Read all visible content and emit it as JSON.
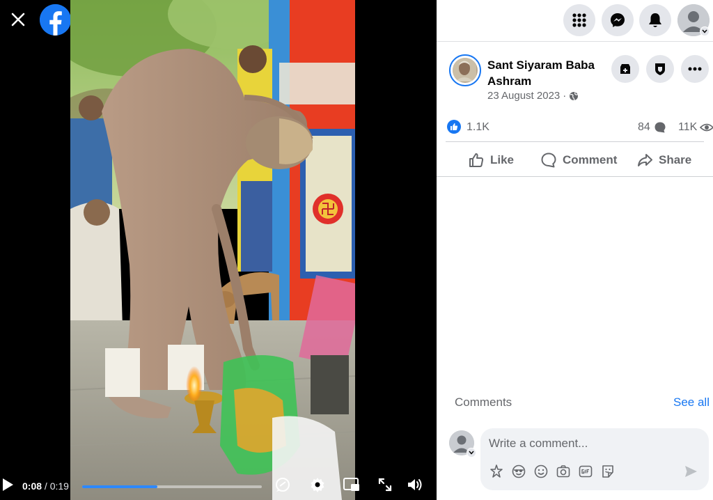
{
  "colors": {
    "brand": "#1877f2",
    "progress": "#2d88ff",
    "muted_text": "#65676b",
    "button_bg": "#e4e6eb"
  },
  "video": {
    "current_time": "0:08",
    "time_separator": "/",
    "duration": "0:19",
    "progress_fraction": 0.42
  },
  "post": {
    "page_name": "Sant Siyaram Baba Ashram",
    "date": "23 August 2023",
    "date_separator": "·",
    "audience_icon": "globe-icon"
  },
  "stats": {
    "reactions": "1.1K",
    "comments": "84",
    "views": "11K"
  },
  "actions": {
    "like": "Like",
    "comment": "Comment",
    "share": "Share"
  },
  "comments": {
    "label": "Comments",
    "see_all": "See all",
    "placeholder": "Write a comment..."
  },
  "icons": {
    "nav": [
      "menu-grid-icon",
      "messenger-icon",
      "notifications-bell-icon",
      "account-avatar"
    ],
    "composer": [
      "avatar-sticker-icon",
      "emoji-face-icon",
      "smiley-icon",
      "camera-icon",
      "gif-icon",
      "sticker-icon",
      "send-icon"
    ]
  }
}
